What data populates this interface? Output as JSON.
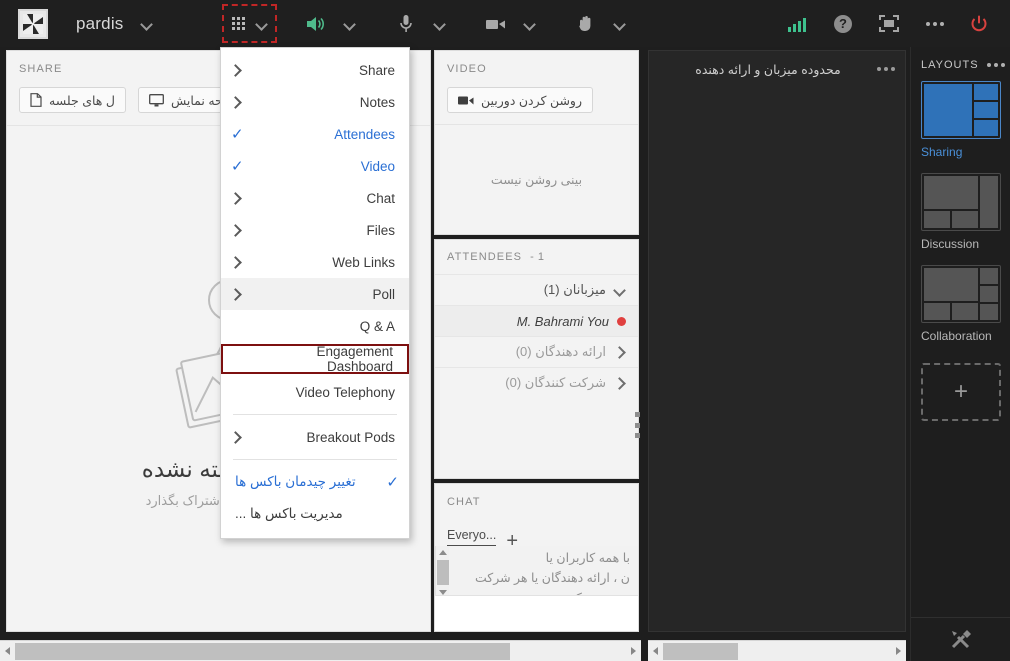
{
  "topbar": {
    "logo": "app-logo",
    "room_title": "pardis",
    "icons": {
      "title_chevron": "chevron-down-icon",
      "grid": "grid-apps-icon",
      "grid_chevron": "chevron-down-icon",
      "speaker": "speaker-icon",
      "speaker_chevron": "chevron-down-icon",
      "mic": "microphone-icon",
      "mic_chevron": "chevron-down-icon",
      "camera": "camera-icon",
      "camera_chevron": "chevron-down-icon",
      "hand": "raise-hand-icon",
      "hand_chevron": "chevron-down-icon",
      "signal": "signal-bars-icon",
      "help": "help-icon",
      "help_glyph": "?",
      "fullscreen": "fullscreen-icon",
      "more": "more-options-icon",
      "power": "end-meeting-power-icon"
    },
    "accent_highlight": "#c02626",
    "signal_color": "#3ec18e",
    "power_color": "#d8423f"
  },
  "menu": {
    "items": [
      {
        "label": "Share",
        "marker": "chevron",
        "blue": false,
        "highlight": false,
        "boxed": false,
        "rtl": false
      },
      {
        "label": "Notes",
        "marker": "chevron",
        "blue": false,
        "highlight": false,
        "boxed": false,
        "rtl": false
      },
      {
        "label": "Attendees",
        "marker": "check",
        "blue": true,
        "highlight": false,
        "boxed": false,
        "rtl": false
      },
      {
        "label": "Video",
        "marker": "check",
        "blue": true,
        "highlight": false,
        "boxed": false,
        "rtl": false
      },
      {
        "label": "Chat",
        "marker": "chevron",
        "blue": false,
        "highlight": false,
        "boxed": false,
        "rtl": false
      },
      {
        "label": "Files",
        "marker": "chevron",
        "blue": false,
        "highlight": false,
        "boxed": false,
        "rtl": false
      },
      {
        "label": "Web Links",
        "marker": "chevron",
        "blue": false,
        "highlight": false,
        "boxed": false,
        "rtl": false
      },
      {
        "label": "Poll",
        "marker": "chevron",
        "blue": false,
        "highlight": true,
        "boxed": false,
        "rtl": false
      },
      {
        "label": "Q & A",
        "marker": "none",
        "blue": false,
        "highlight": false,
        "boxed": false,
        "rtl": false
      },
      {
        "label": "Engagement Dashboard",
        "marker": "none",
        "blue": false,
        "highlight": false,
        "boxed": true,
        "rtl": false
      },
      {
        "label": "Video Telephony",
        "marker": "none",
        "blue": false,
        "highlight": false,
        "boxed": false,
        "rtl": false
      },
      {
        "separator": true
      },
      {
        "label": "Breakout Pods",
        "marker": "chevron",
        "blue": false,
        "highlight": false,
        "boxed": false,
        "rtl": false
      },
      {
        "separator": true
      },
      {
        "label": "تغییر چیدمان باکس ها",
        "marker": "check",
        "blue": true,
        "highlight": false,
        "boxed": false,
        "rtl": true
      },
      {
        "label": "مدیریت باکس ها ...",
        "marker": "none",
        "blue": false,
        "highlight": false,
        "boxed": false,
        "rtl": true
      }
    ],
    "box_border_color": "#7d1010",
    "blue": "#2a6fd4"
  },
  "share_pod": {
    "title": "SHARE",
    "buttons": [
      {
        "label": "صفحه نمایش",
        "icon": "monitor-icon"
      },
      {
        "label": "ل های جلسه",
        "icon": "document-icon"
      }
    ],
    "empty_title": "ب گذاشته نشده",
    "empty_sub": "مطلبی را به اشتراک بگذارد"
  },
  "video_pod": {
    "title": "VIDEO",
    "button_label": "روشن کردن دوربین",
    "button_icon": "camera-icon",
    "empty_message": "بینی روشن نیست"
  },
  "attendees_pod": {
    "title": "ATTENDEES",
    "count_label": "- 1",
    "groups": [
      {
        "label": "میزبانان (1)",
        "marker": "caret-down",
        "muted": false
      },
      {
        "label": "ارائه دهندگان (0)",
        "marker": "caret-right",
        "muted": true
      },
      {
        "label": "شرکت کنندگان (0)",
        "marker": "caret-right",
        "muted": true
      }
    ],
    "person": {
      "name": "M. Bahrami  You",
      "status_color": "#e0403f"
    }
  },
  "chat_pod": {
    "title": "CHAT",
    "tab_label": "Everyo...",
    "add_label": "+",
    "message_lines": [
      "با همه کاربران یا",
      "ن ، ارائه دهندگان یا هر شرکت",
      "ه صحبت کنند"
    ]
  },
  "stage": {
    "title": "محدوده میزبان و ارائه دهنده",
    "menu_icon": "more-options-icon"
  },
  "layouts": {
    "title": "LAYOUTS",
    "menu_icon": "more-options-icon",
    "items": [
      {
        "name": "Sharing",
        "selected": true
      },
      {
        "name": "Discussion",
        "selected": false
      },
      {
        "name": "Collaboration",
        "selected": false
      }
    ],
    "add_label": "+",
    "footer_icon": "tools-icon",
    "selected_color": "#4a90d9"
  },
  "scrollbars": {
    "left_arrow": "scroll-left-arrow",
    "right_arrow": "scroll-right-arrow"
  }
}
